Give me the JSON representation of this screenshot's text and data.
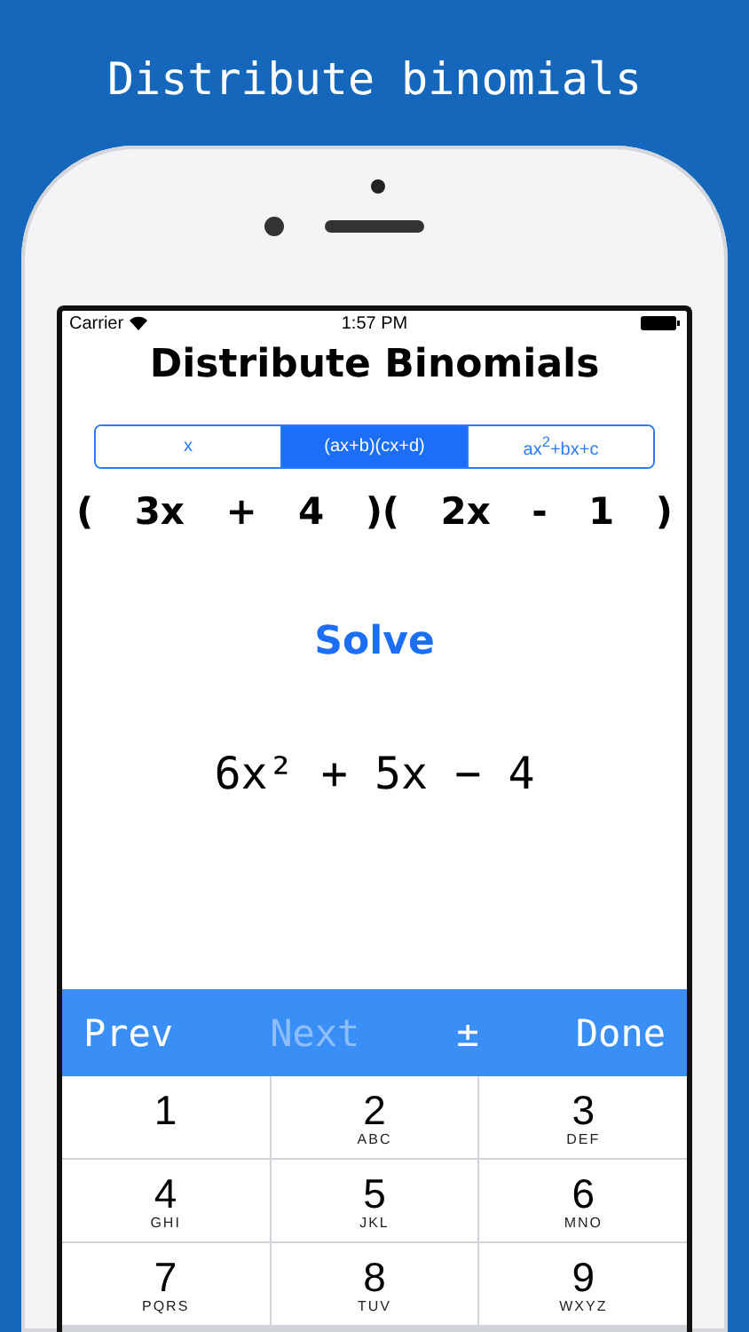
{
  "banner": {
    "title": "Distribute binomials"
  },
  "status_bar": {
    "carrier": "Carrier",
    "time": "1:57 PM"
  },
  "title": "Distribute Binomials",
  "segments": [
    {
      "label": "x",
      "selected": false
    },
    {
      "label": "(ax+b)(cx+d)",
      "selected": true
    },
    {
      "label": "ax$^{2}$+bx+c",
      "selected": false
    }
  ],
  "equation": [
    "(",
    "3x",
    "+",
    "4",
    ")(",
    "2x",
    "-",
    "1",
    ")"
  ],
  "solve_button": "Solve",
  "answer": "6x² + 5x − 4",
  "toolbar": [
    {
      "label": "Prev",
      "disabled": false
    },
    {
      "label": "Next",
      "disabled": true
    },
    {
      "label": "±",
      "disabled": false
    },
    {
      "label": "Done",
      "disabled": false
    }
  ],
  "keys": [
    {
      "digit": "1"
    },
    {
      "digit": "2",
      "letters": "ABC"
    },
    {
      "digit": "3",
      "letters": "DEF"
    },
    {
      "digit": "4",
      "letters": "GHI"
    },
    {
      "digit": "5",
      "letters": "JKL"
    },
    {
      "digit": "6",
      "letters": "MNO"
    },
    {
      "digit": "7",
      "letters": "PQRS"
    },
    {
      "digit": "8",
      "letters": "TUV"
    },
    {
      "digit": "9",
      "letters": "WXYZ"
    }
  ]
}
